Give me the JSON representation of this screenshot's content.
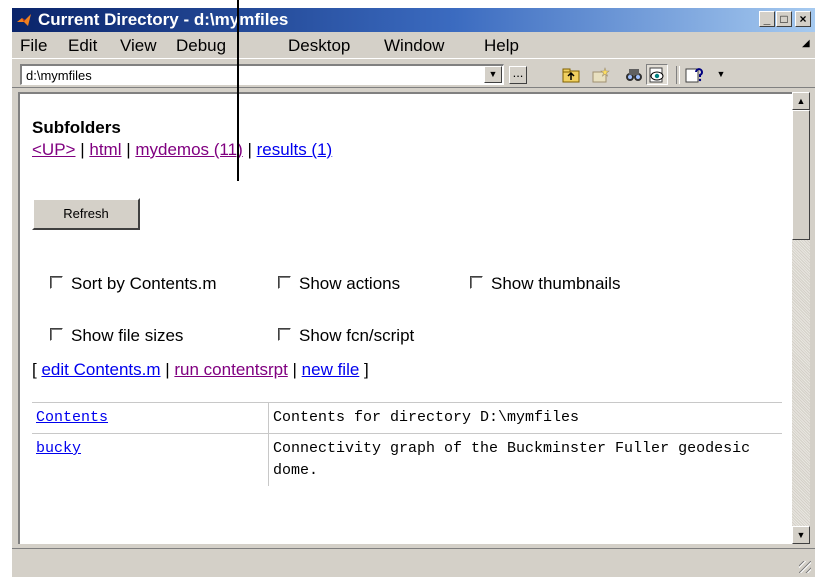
{
  "window": {
    "title": "Current Directory - d:\\mymfiles",
    "minimize_glyph": "_",
    "maximize_glyph": "□",
    "close_glyph": "×"
  },
  "menubar": {
    "file": "File",
    "edit": "Edit",
    "view": "View",
    "debug": "Debug",
    "desktop": "Desktop",
    "window": "Window",
    "help": "Help"
  },
  "toolbar": {
    "path_value": "d:\\mymfiles",
    "browse_label": "..."
  },
  "subfolders": {
    "title": "Subfolders",
    "up": "<UP>",
    "html": "html",
    "mydemos": "mydemos (11)",
    "results": "results (1)",
    "separator": " | "
  },
  "refresh_label": "Refresh",
  "options": {
    "sort_by_contents": "Sort by Contents.m",
    "show_actions": "Show actions",
    "show_thumbnails": "Show thumbnails",
    "show_file_sizes": "Show file sizes",
    "show_fcn_script": "Show fcn/script"
  },
  "actions": {
    "open_bracket": "[ ",
    "edit_contents": "edit Contents.m",
    "run_contentsrpt": "run contentsrpt",
    "new_file": "new file",
    "close_bracket": " ]",
    "separator": " | "
  },
  "contents_table": {
    "rows": [
      {
        "name": "Contents",
        "description": "Contents for directory D:\\mymfiles"
      },
      {
        "name": "bucky",
        "description": "Connectivity graph of the Buckminster Fuller geodesic dome."
      }
    ]
  }
}
